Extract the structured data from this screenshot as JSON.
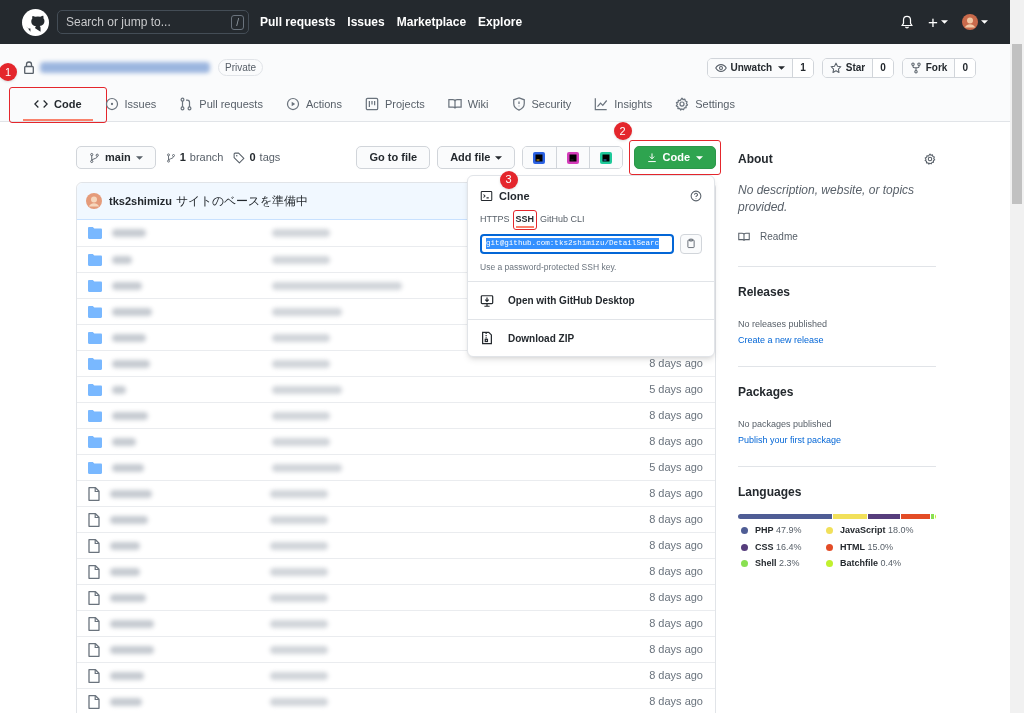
{
  "header": {
    "search_placeholder": "Search or jump to...",
    "search_key": "/",
    "nav": [
      "Pull requests",
      "Issues",
      "Marketplace",
      "Explore"
    ],
    "plus": "+"
  },
  "repo": {
    "visibility": "Private",
    "actions": [
      {
        "kind": "watch",
        "label": "Unwatch",
        "count": "1"
      },
      {
        "kind": "star",
        "label": "Star",
        "count": "0"
      },
      {
        "kind": "fork",
        "label": "Fork",
        "count": "0"
      }
    ]
  },
  "tabs": [
    {
      "label": "Code",
      "selected": true
    },
    {
      "label": "Issues",
      "selected": false
    },
    {
      "label": "Pull requests",
      "selected": false
    },
    {
      "label": "Actions",
      "selected": false
    },
    {
      "label": "Projects",
      "selected": false
    },
    {
      "label": "Wiki",
      "selected": false
    },
    {
      "label": "Security",
      "selected": false
    },
    {
      "label": "Insights",
      "selected": false
    },
    {
      "label": "Settings",
      "selected": false
    }
  ],
  "toolbar": {
    "branch": "main",
    "branches_count": "1",
    "branches_label": "branch",
    "tags_count": "0",
    "tags_label": "tags",
    "go_to_file": "Go to file",
    "add_file": "Add file",
    "code_button": "Code"
  },
  "commit": {
    "author": "tks2shimizu",
    "message": "サイトのベースを準備中"
  },
  "files": [
    {
      "kind": "folder"
    },
    {
      "kind": "folder"
    },
    {
      "kind": "folder"
    },
    {
      "kind": "folder"
    },
    {
      "kind": "folder"
    },
    {
      "kind": "folder",
      "time": "8 days ago"
    },
    {
      "kind": "folder",
      "time": "5 days ago"
    },
    {
      "kind": "folder",
      "time": "8 days ago"
    },
    {
      "kind": "folder",
      "time": "8 days ago"
    },
    {
      "kind": "folder",
      "time": "5 days ago"
    },
    {
      "kind": "file",
      "time": "8 days ago"
    },
    {
      "kind": "file",
      "time": "8 days ago"
    },
    {
      "kind": "file",
      "time": "8 days ago"
    },
    {
      "kind": "file",
      "time": "8 days ago"
    },
    {
      "kind": "file",
      "time": "8 days ago"
    },
    {
      "kind": "file",
      "time": "8 days ago"
    },
    {
      "kind": "file",
      "time": "8 days ago"
    },
    {
      "kind": "file",
      "time": "8 days ago"
    },
    {
      "kind": "file",
      "time": "8 days ago"
    }
  ],
  "clone_menu": {
    "title": "Clone",
    "protocols": [
      {
        "label": "HTTPS",
        "selected": false
      },
      {
        "label": "SSH",
        "selected": true
      },
      {
        "label": "GitHub CLI",
        "selected": false
      }
    ],
    "url": "git@github.com:tks2shimizu/DetailSearc",
    "hint": "Use a password-protected SSH key.",
    "options": [
      {
        "label": "Open with GitHub Desktop"
      },
      {
        "label": "Download ZIP"
      }
    ]
  },
  "about": {
    "title": "About",
    "description": "No description, website, or topics provided.",
    "readme": "Readme"
  },
  "releases": {
    "title": "Releases",
    "text": "No releases published",
    "link": "Create a new release"
  },
  "packages": {
    "title": "Packages",
    "text": "No packages published",
    "link": "Publish your first package"
  },
  "languages": {
    "title": "Languages",
    "items": [
      {
        "name": "PHP",
        "percent": "47.9%",
        "color": "#4f5d95"
      },
      {
        "name": "JavaScript",
        "percent": "18.0%",
        "color": "#f1e05a"
      },
      {
        "name": "CSS",
        "percent": "16.4%",
        "color": "#563d7c"
      },
      {
        "name": "HTML",
        "percent": "15.0%",
        "color": "#e34c26"
      },
      {
        "name": "Shell",
        "percent": "2.3%",
        "color": "#89e051"
      },
      {
        "name": "Batchfile",
        "percent": "0.4%",
        "color": "#c1f12e"
      }
    ]
  },
  "annotations": [
    {
      "label": "1"
    },
    {
      "label": "2"
    },
    {
      "label": "3"
    }
  ]
}
